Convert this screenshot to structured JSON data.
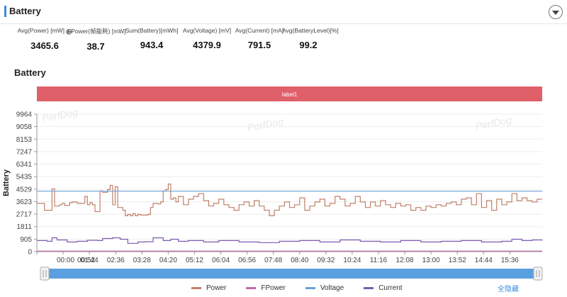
{
  "header": {
    "title": "Battery"
  },
  "stats": [
    {
      "label": "Avg(Power) [mW]",
      "value": "3465.6",
      "help": "?"
    },
    {
      "label": "FPower(帧能耗) [mW]",
      "value": "38.7"
    },
    {
      "label": "Sum(Battery)[mWh]",
      "value": "943.4"
    },
    {
      "label": "Avg(Voltage) [mV]",
      "value": "4379.9"
    },
    {
      "label": "Avg(Current) [mA]",
      "value": "791.5"
    },
    {
      "label": "Avg(BatteryLevel)[%]",
      "value": "99.2"
    }
  ],
  "section_title": "Battery",
  "watermark": "PerfDog",
  "colors": {
    "power": "#c0806a",
    "fpower": "#c06aa8",
    "voltage": "#6aa0d6",
    "current": "#7a5bb0",
    "label_band": "#e0606a",
    "slider": "#5aa0e0",
    "accent": "#3c8dde"
  },
  "chart_data": {
    "type": "line",
    "ylabel": "Battery",
    "ylim": [
      0,
      9964
    ],
    "yticks": [
      9964,
      9058,
      8153,
      7247,
      6341,
      5435,
      4529,
      3623,
      2717,
      1811,
      905,
      0
    ],
    "xlim": [
      0,
      1000
    ],
    "xtick_labels": [
      "00:00",
      "00:52",
      "01:44",
      "02:36",
      "03:28",
      "04:20",
      "05:12",
      "06:04",
      "06:56",
      "07:48",
      "08:40",
      "09:32",
      "10:24",
      "11:16",
      "12:08",
      "13:00",
      "13:52",
      "14:44",
      "15:36"
    ],
    "xtick_positions": [
      0,
      52,
      104,
      156,
      208,
      260,
      312,
      364,
      416,
      468,
      520,
      572,
      624,
      676,
      728,
      780,
      832,
      884,
      936
    ],
    "band_label": "label1",
    "series": [
      {
        "name": "Power",
        "x": [
          0,
          15,
          30,
          35,
          45,
          50,
          55,
          65,
          70,
          80,
          95,
          100,
          105,
          110,
          115,
          125,
          130,
          140,
          145,
          150,
          155,
          160,
          170,
          175,
          180,
          185,
          190,
          195,
          200,
          205,
          220,
          225,
          230,
          240,
          245,
          250,
          255,
          260,
          265,
          270,
          275,
          280,
          290,
          300,
          310,
          320,
          330,
          340,
          350,
          360,
          370,
          380,
          390,
          400,
          410,
          420,
          430,
          440,
          450,
          460,
          470,
          480,
          490,
          500,
          510,
          520,
          530,
          540,
          550,
          560,
          570,
          580,
          590,
          600,
          610,
          620,
          630,
          640,
          650,
          660,
          670,
          680,
          690,
          700,
          710,
          720,
          730,
          740,
          750,
          760,
          770,
          780,
          790,
          800,
          810,
          820,
          830,
          840,
          850,
          860,
          870,
          880,
          890,
          900,
          910,
          920,
          930,
          940,
          950,
          960,
          970,
          980,
          990,
          1000
        ],
        "values": [
          3500,
          3000,
          4550,
          3300,
          3400,
          3500,
          3350,
          3550,
          3600,
          3500,
          4000,
          3400,
          3550,
          3400,
          2900,
          4400,
          4300,
          4500,
          4800,
          3400,
          4700,
          3200,
          3000,
          2600,
          2700,
          2600,
          2750,
          2600,
          2700,
          2650,
          2700,
          3200,
          3500,
          3450,
          3600,
          4400,
          4500,
          4900,
          3800,
          3900,
          3600,
          4000,
          3400,
          3800,
          4000,
          4200,
          3700,
          3300,
          3500,
          3800,
          3400,
          3200,
          3000,
          3400,
          3600,
          3300,
          3700,
          3300,
          3000,
          2600,
          3000,
          3300,
          3600,
          3200,
          3400,
          3900,
          3000,
          3300,
          3600,
          3800,
          3300,
          3500,
          4000,
          3800,
          3300,
          3500,
          4000,
          3600,
          3200,
          3600,
          3300,
          3700,
          3400,
          3200,
          3500,
          3300,
          3400,
          3000,
          3200,
          3000,
          3300,
          3200,
          3400,
          3300,
          3500,
          3600,
          3400,
          3800,
          3900,
          3400,
          4200,
          3200,
          3700,
          3000,
          3800,
          3400,
          3600,
          4200,
          3700,
          3900,
          3700,
          3600,
          3800,
          3800
        ]
      },
      {
        "name": "FPower",
        "x": [
          0,
          1000
        ],
        "values": [
          38.7,
          38.7
        ]
      },
      {
        "name": "Voltage",
        "x": [
          0,
          1000
        ],
        "values": [
          4380,
          4370
        ]
      },
      {
        "name": "Current",
        "x": [
          0,
          20,
          30,
          40,
          60,
          80,
          100,
          120,
          130,
          150,
          165,
          180,
          200,
          215,
          230,
          250,
          265,
          280,
          300,
          330,
          360,
          400,
          440,
          480,
          520,
          560,
          600,
          640,
          680,
          720,
          760,
          800,
          840,
          880,
          920,
          940,
          960,
          980,
          1000
        ],
        "values": [
          800,
          750,
          1000,
          850,
          700,
          750,
          820,
          800,
          950,
          1000,
          900,
          600,
          700,
          720,
          1000,
          800,
          900,
          750,
          800,
          700,
          800,
          700,
          650,
          750,
          800,
          700,
          850,
          750,
          700,
          800,
          700,
          750,
          800,
          700,
          750,
          900,
          800,
          850,
          800
        ]
      }
    ]
  },
  "legend": [
    "Power",
    "FPower",
    "Voltage",
    "Current"
  ],
  "hide_all_label": "全隐藏"
}
